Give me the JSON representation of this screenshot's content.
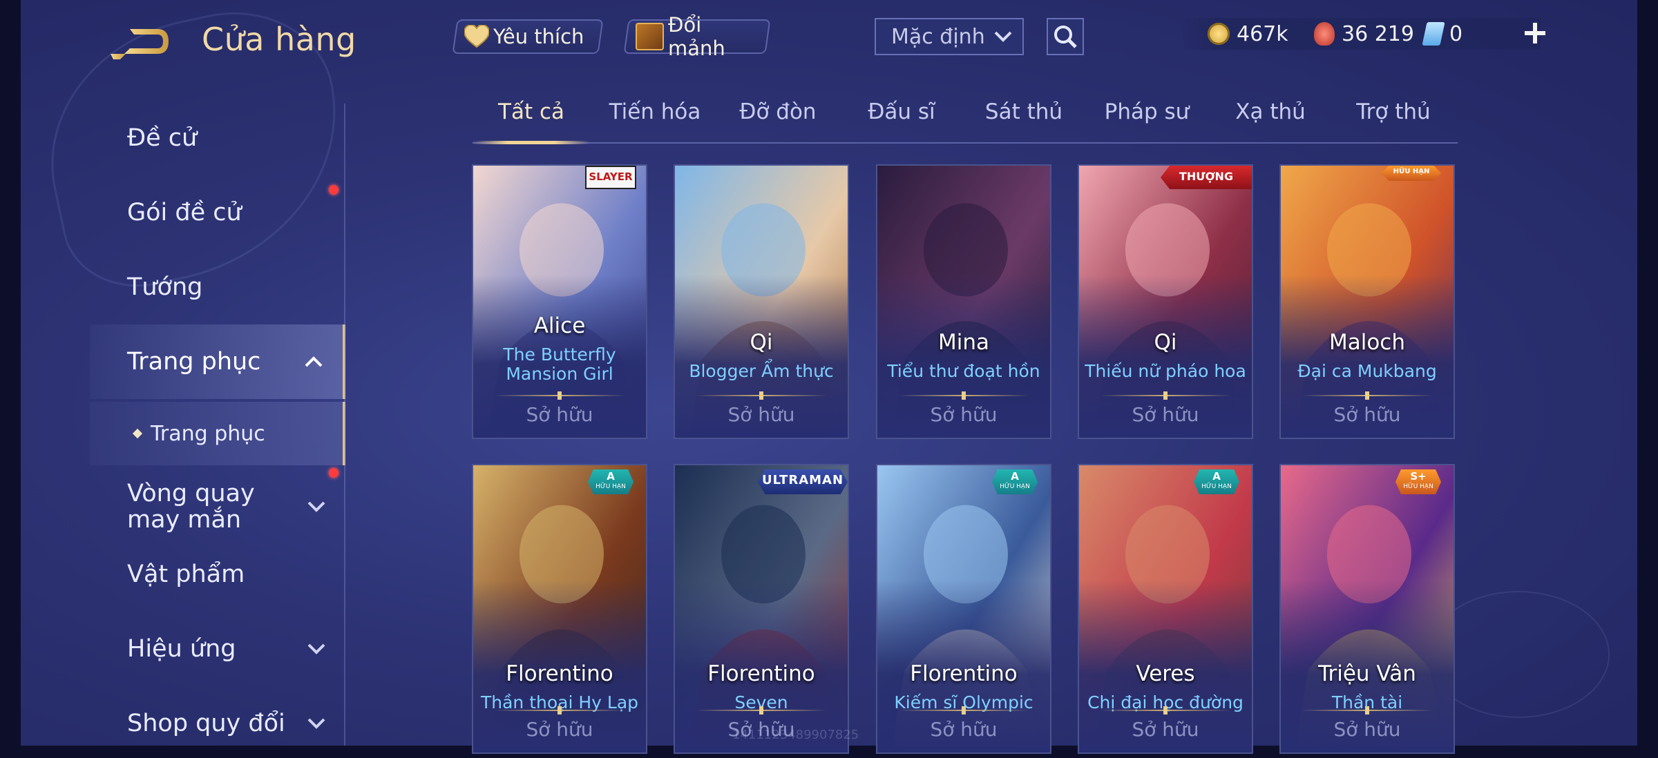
{
  "header": {
    "title": "Cửa hàng",
    "favorites_label": "Yêu thích",
    "exchange_label": "Đổi mảnh",
    "sort_value": "Mặc định"
  },
  "currencies": {
    "gold": "467k",
    "vouchers": "36 219",
    "tickets": "0"
  },
  "sidebar": {
    "items": [
      {
        "label": "Đề cử"
      },
      {
        "label": "Gói đề cử"
      },
      {
        "label": "Tướng"
      },
      {
        "label": "Trang phục"
      },
      {
        "label": "Trang phục"
      },
      {
        "label": "Vòng quay may mắn"
      },
      {
        "label": "Vật phẩm"
      },
      {
        "label": "Hiệu ứng"
      },
      {
        "label": "Shop quy đổi"
      }
    ]
  },
  "tabs": [
    "Tất cả",
    "Tiến hóa",
    "Đỡ đòn",
    "Đấu sĩ",
    "Sát thủ",
    "Pháp sư",
    "Xạ thủ",
    "Trợ thủ"
  ],
  "cards": [
    {
      "hero": "Alice",
      "skin": "The Butterfly Mansion Girl",
      "status": "Sở hữu",
      "badge": "SLAYER",
      "colors": [
        "#f2d7d0",
        "#6e7fc8",
        "#3a3f8a"
      ]
    },
    {
      "hero": "Qi",
      "skin": "Blogger Ẩm thực",
      "status": "Sở hữu",
      "badge": "",
      "colors": [
        "#7fb6e8",
        "#e6c9a8",
        "#a86a3a"
      ]
    },
    {
      "hero": "Mina",
      "skin": "Tiểu thư đoạt hồn",
      "status": "Sở hữu",
      "badge": "",
      "colors": [
        "#2a1c3e",
        "#6b3a66",
        "#1c1a36"
      ]
    },
    {
      "hero": "Qi",
      "skin": "Thiếu nữ pháo hoa",
      "status": "Sở hữu",
      "badge": "THƯỢNG HẠNG",
      "colors": [
        "#f0a6b0",
        "#8e2f48",
        "#4a1e36"
      ]
    },
    {
      "hero": "Maloch",
      "skin": "Đại ca Mukbang",
      "status": "Sở hữu",
      "badge": "HỮU HẠN",
      "colors": [
        "#f0a84a",
        "#d0532a",
        "#5a2a5e"
      ]
    },
    {
      "hero": "Florentino",
      "skin": "Thần thoại Hy Lạp",
      "status": "Sở hữu",
      "badge": "A",
      "badge_sub": "HỮU HẠN",
      "colors": [
        "#d6b26a",
        "#7a3a1e",
        "#3a2420"
      ]
    },
    {
      "hero": "Florentino",
      "skin": "Seven",
      "status": "Sở hữu",
      "badge": "ULTRAMAN",
      "colors": [
        "#1c2e52",
        "#5a6a86",
        "#9a2a2a"
      ]
    },
    {
      "hero": "Florentino",
      "skin": "Kiếm sĩ Olympic",
      "status": "Sở hữu",
      "badge": "A",
      "badge_sub": "HỮU HẠN",
      "colors": [
        "#9ac6f0",
        "#3a5a9a",
        "#e8e2d6"
      ]
    },
    {
      "hero": "Veres",
      "skin": "Chị đại học đường",
      "status": "Sở hữu",
      "badge": "A",
      "badge_sub": "HỮU HẠN",
      "colors": [
        "#d88a6a",
        "#c23a4a",
        "#6a3a3a"
      ]
    },
    {
      "hero": "Triệu Vân",
      "skin": "Thần tài",
      "status": "Sở hữu",
      "badge": "S+",
      "badge_sub": "HỮU HẠN",
      "colors": [
        "#e86a8a",
        "#5a2a8a",
        "#f0c25a"
      ]
    }
  ],
  "footer": {
    "watermark": "1411123489907825"
  }
}
